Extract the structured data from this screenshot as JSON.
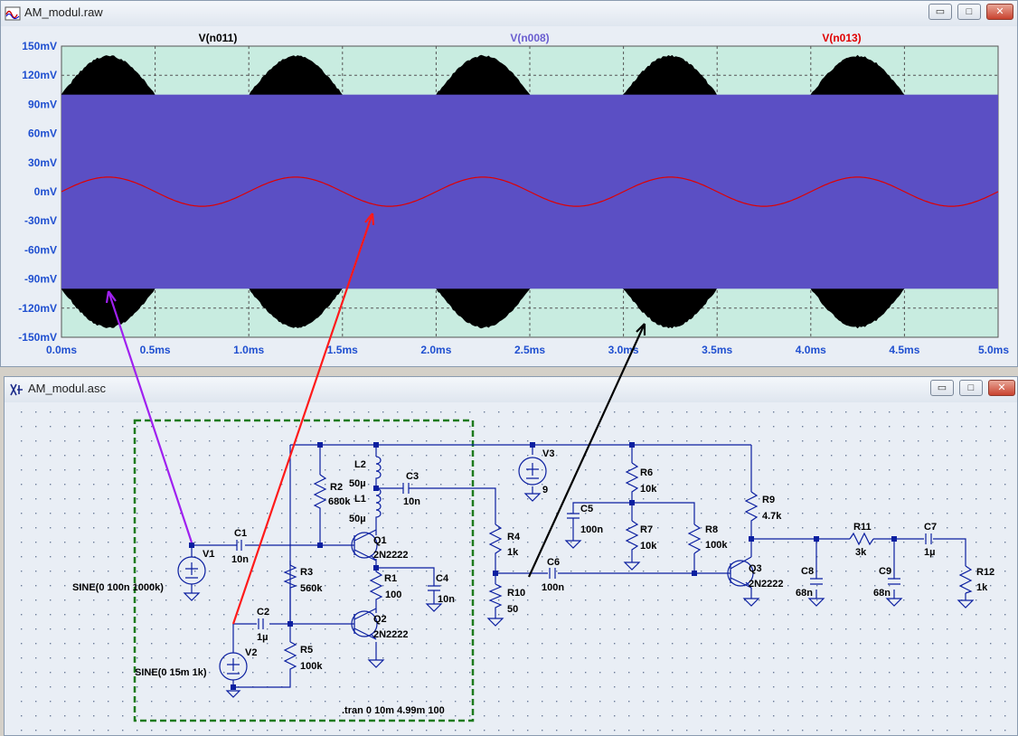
{
  "waveform_window": {
    "title": "AM_modul.raw",
    "buttons": {
      "minimize": "▭",
      "maximize": "□",
      "close": "✕"
    },
    "traces": [
      {
        "name": "V(n011)",
        "color": "#000000"
      },
      {
        "name": "V(n008)",
        "color": "#5b4fc4"
      },
      {
        "name": "V(n013)",
        "color": "#ff0000"
      }
    ],
    "colors": {
      "plot_bg": "#c8ece0",
      "grid": "#444444",
      "axis_text": "#1f4fd0"
    }
  },
  "chart_data": {
    "type": "line",
    "xlabel": "",
    "ylabel": "",
    "x_ticks": [
      "0.0ms",
      "0.5ms",
      "1.0ms",
      "1.5ms",
      "2.0ms",
      "2.5ms",
      "3.0ms",
      "3.5ms",
      "4.0ms",
      "4.5ms",
      "5.0ms"
    ],
    "y_ticks": [
      "150mV",
      "120mV",
      "90mV",
      "60mV",
      "30mV",
      "0mV",
      "-30mV",
      "-60mV",
      "-90mV",
      "-120mV",
      "-150mV"
    ],
    "xlim": [
      0,
      5
    ],
    "ylim": [
      -150,
      150
    ],
    "series": [
      {
        "name": "V(n011)",
        "kind": "am-envelope",
        "carrier_amplitude_mV": 100,
        "modulation_amplitude_mV": 40,
        "modulation_freq_kHz": 1
      },
      {
        "name": "V(n008)",
        "kind": "band",
        "amplitude_mV": 100
      },
      {
        "name": "V(n013)",
        "kind": "sine",
        "amplitude_mV": 15,
        "freq_kHz": 1
      }
    ]
  },
  "schematic_window": {
    "title": "AM_modul.asc",
    "buttons": {
      "minimize": "▭",
      "maximize": "□",
      "close": "✕"
    },
    "colors": {
      "wire": "#0b1fa0",
      "bg": "#e9eef5",
      "dot": "#6b7b99",
      "frame": "#1d7a1d"
    },
    "components": {
      "V1": {
        "name": "V1",
        "value": "SINE(0 100n 1000k)"
      },
      "V2": {
        "name": "V2",
        "value": "SINE(0 15m 1k)"
      },
      "V3": {
        "name": "V3",
        "value": "9"
      },
      "C1": {
        "name": "C1",
        "value": "10n"
      },
      "C2": {
        "name": "C2",
        "value": "1µ"
      },
      "C3": {
        "name": "C3",
        "value": "10n"
      },
      "C4": {
        "name": "C4",
        "value": "10n"
      },
      "C5": {
        "name": "C5",
        "value": "100n"
      },
      "C6": {
        "name": "C6",
        "value": "100n"
      },
      "C7": {
        "name": "C7",
        "value": "1µ"
      },
      "C8": {
        "name": "C8",
        "value": "68n"
      },
      "C9": {
        "name": "C9",
        "value": "68n"
      },
      "R1": {
        "name": "R1",
        "value": "100"
      },
      "R2": {
        "name": "R2",
        "value": "680k"
      },
      "R3": {
        "name": "R3",
        "value": "560k"
      },
      "R4": {
        "name": "R4",
        "value": "1k"
      },
      "R5": {
        "name": "R5",
        "value": "100k"
      },
      "R6": {
        "name": "R6",
        "value": "10k"
      },
      "R7": {
        "name": "R7",
        "value": "10k"
      },
      "R8": {
        "name": "R8",
        "value": "100k"
      },
      "R9": {
        "name": "R9",
        "value": "4.7k"
      },
      "R10": {
        "name": "R10",
        "value": "50"
      },
      "R11": {
        "name": "R11",
        "value": "3k"
      },
      "R12": {
        "name": "R12",
        "value": "1k"
      },
      "L1": {
        "name": "L1",
        "value": "50µ"
      },
      "L2": {
        "name": "L2",
        "value": "50µ"
      },
      "Q1": {
        "name": "Q1",
        "value": "2N2222"
      },
      "Q2": {
        "name": "Q2",
        "value": "2N2222"
      },
      "Q3": {
        "name": "Q3",
        "value": "2N2222"
      }
    },
    "directive": ".tran 0 10m 4.99m 100"
  },
  "arrows": [
    {
      "color": "#a020f0"
    },
    {
      "color": "#ff1a1a"
    },
    {
      "color": "#000000"
    }
  ]
}
